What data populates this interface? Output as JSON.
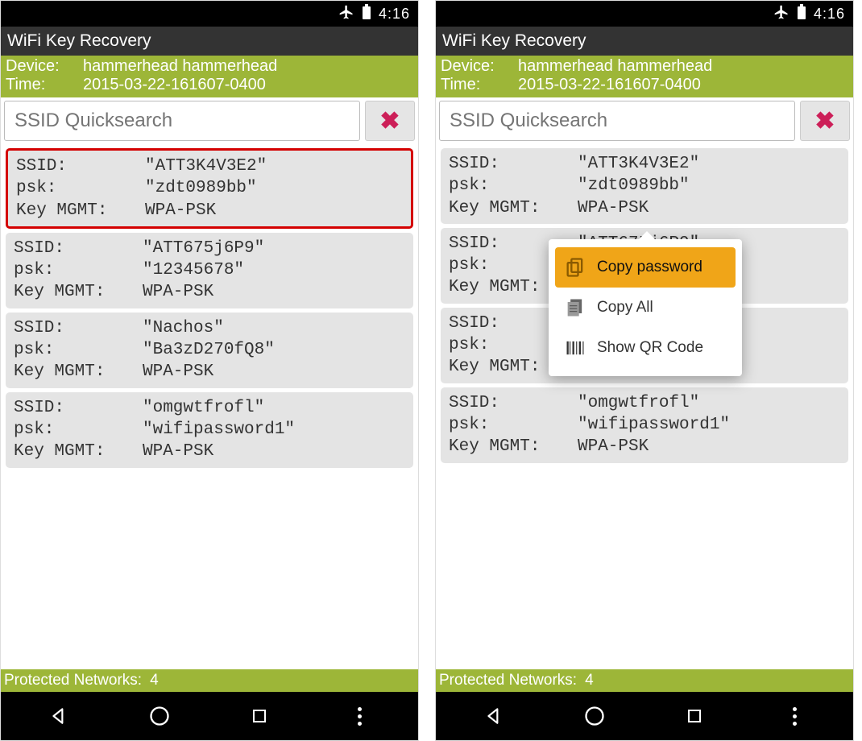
{
  "status": {
    "time": "4:16"
  },
  "app": {
    "title": "WiFi Key Recovery"
  },
  "info": {
    "device_label": "Device:",
    "device_value": "hammerhead hammerhead",
    "time_label": "Time:",
    "time_value": "2015-03-22-161607-0400"
  },
  "search": {
    "placeholder": "SSID Quicksearch"
  },
  "labels": {
    "ssid": "SSID:",
    "psk": "psk:",
    "keymgmt": "Key MGMT:"
  },
  "networks": [
    {
      "ssid": "\"ATT3K4V3E2\"",
      "psk": "\"zdt0989bb\"",
      "keymgmt": "WPA-PSK"
    },
    {
      "ssid": "\"ATT675j6P9\"",
      "psk": "\"12345678\"",
      "keymgmt": "WPA-PSK"
    },
    {
      "ssid": "\"Nachos\"",
      "psk": "\"Ba3zD270fQ8\"",
      "keymgmt": "WPA-PSK"
    },
    {
      "ssid": "\"omgwtfrofl\"",
      "psk": "\"wifipassword1\"",
      "keymgmt": "WPA-PSK"
    }
  ],
  "networks_right_partial": {
    "ssid_cut": "\"ATT675j6P9\"",
    "omg_ssid_cut": "\"omgwtfrofl\""
  },
  "popup": {
    "copy_password": "Copy password",
    "copy_all": "Copy All",
    "show_qr": "Show QR Code"
  },
  "footer": {
    "label": "Protected Networks:",
    "count": "4"
  }
}
